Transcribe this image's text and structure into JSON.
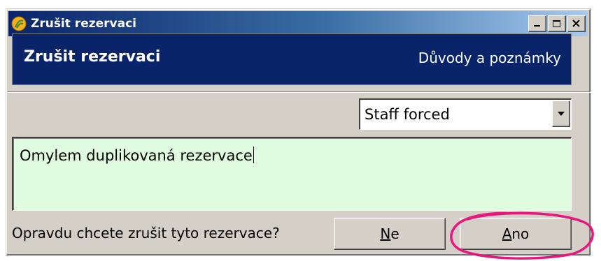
{
  "window": {
    "title": "Zrušit rezervaci"
  },
  "header": {
    "title": "Zrušit rezervaci",
    "subtitle": "Důvody a poznámky"
  },
  "reason_select": {
    "value": "Staff forced"
  },
  "note": {
    "value": "Omylem duplikovaná rezervace"
  },
  "confirm": {
    "question": "Opravdu chcete zrušit tyto rezervace?",
    "no_mnemonic": "N",
    "no_rest": "e",
    "yes_mnemonic": "A",
    "yes_rest": "no"
  },
  "colors": {
    "header_bg": "#0a246a",
    "note_bg": "#e0fce0",
    "highlight": "#e8177d"
  },
  "icons": [
    "app-icon",
    "minimize-icon",
    "maximize-icon",
    "close-icon",
    "dropdown-arrow-icon"
  ]
}
